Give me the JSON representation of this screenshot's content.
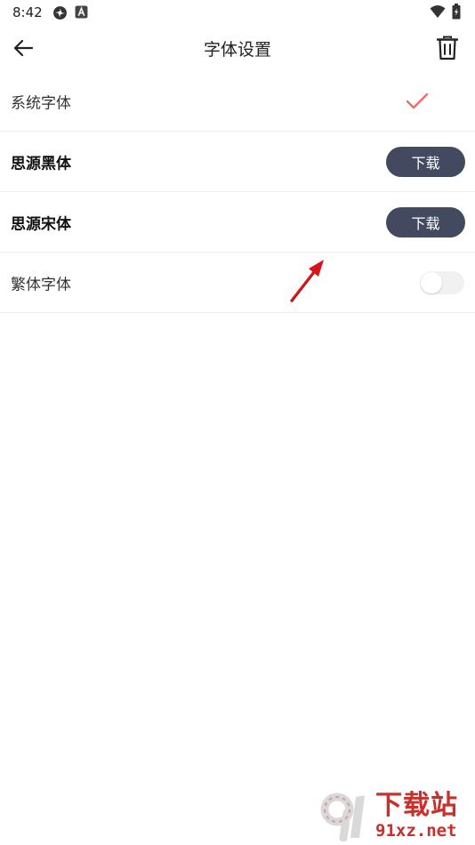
{
  "status_bar": {
    "time": "8:42",
    "icons_left": [
      "pinwheel-icon",
      "app-a-icon"
    ],
    "icons_right": [
      "wifi-icon",
      "battery-icon"
    ]
  },
  "app_bar": {
    "title": "字体设置",
    "back_icon": "arrow-left-icon",
    "delete_icon": "trash-icon"
  },
  "fonts": [
    {
      "label": "系统字体",
      "state": "selected",
      "indicator": "check-icon"
    },
    {
      "label": "思源黑体",
      "action_label": "下载"
    },
    {
      "label": "思源宋体",
      "action_label": "下载"
    },
    {
      "label": "繁体字体",
      "toggle_on": false
    }
  ],
  "watermark": {
    "title": "下载站",
    "url": "91xz.net"
  },
  "colors": {
    "accent_check": "#ef6b6b",
    "download_button_bg": "#434a5f",
    "annotation_arrow": "#d8141a",
    "watermark": "#c9302c"
  }
}
